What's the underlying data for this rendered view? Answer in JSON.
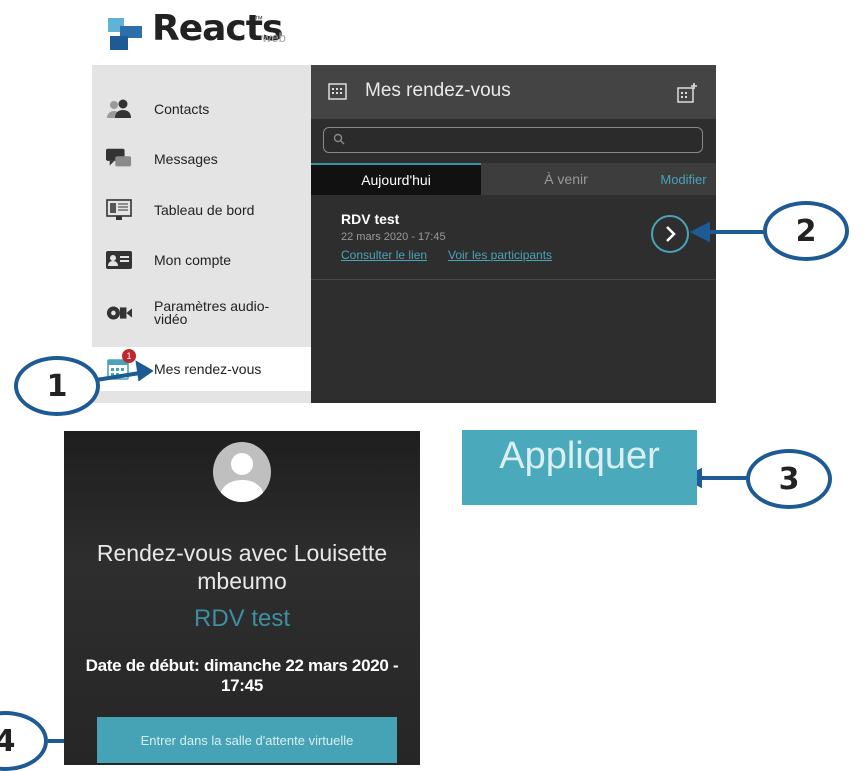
{
  "brand": {
    "name": "Reacts",
    "tm": "™",
    "suffix": "web"
  },
  "sidebar": {
    "items": [
      {
        "label": "Contacts",
        "icon": "contacts-icon"
      },
      {
        "label": "Messages",
        "icon": "messages-icon"
      },
      {
        "label": "Tableau de bord",
        "icon": "dashboard-icon"
      },
      {
        "label": "Mon compte",
        "icon": "account-card-icon"
      },
      {
        "label": "Paramètres audio-\nvidéo",
        "icon": "audio-video-icon"
      },
      {
        "label": "Mes rendez-vous",
        "icon": "calendar-icon",
        "badge": "1"
      }
    ]
  },
  "panel": {
    "title": "Mes rendez-vous",
    "search_placeholder": "",
    "tabs": {
      "today": "Aujourd'hui",
      "upcoming": "À venir",
      "edit": "Modifier"
    },
    "appointment": {
      "title": "RDV test",
      "date": "22 mars 2020 - 17:45",
      "link1": "Consulter le lien",
      "link2": "Voir les participants"
    }
  },
  "callouts": {
    "c1": "1",
    "c2": "2",
    "c3": "3",
    "c4": "4"
  },
  "apply_button": "Appliquer",
  "card": {
    "title": "Rendez-vous avec Louisette mbeumo",
    "subtitle": "RDV test",
    "date": "Date de début: dimanche 22 mars 2020 - 17:45",
    "enter_button": "Entrer dans la salle d'attente virtuelle"
  },
  "colors": {
    "accent": "#4aa3b8",
    "callout_border": "#1e5a94",
    "badge": "#c0272d"
  }
}
